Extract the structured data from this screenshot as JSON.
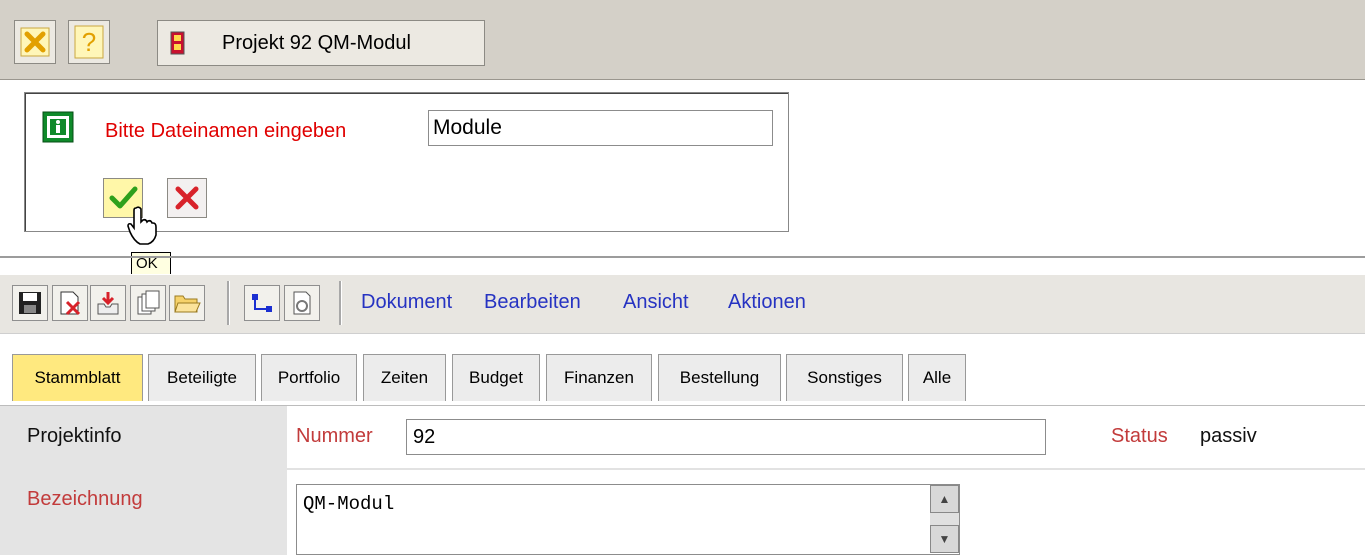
{
  "header": {
    "project_button_label": "Projekt 92 QM-Modul",
    "icons": [
      "close-icon",
      "help-icon",
      "project-icon"
    ]
  },
  "dialog": {
    "label": "Bitte Dateinamen eingeben",
    "filename_value": "Module",
    "ok_tooltip": "OK",
    "icons": [
      "info-icon",
      "ok-check-icon",
      "cancel-x-icon"
    ]
  },
  "toolbar": {
    "icons": [
      "save-icon",
      "delete-doc-icon",
      "inbox-icon",
      "copy-icon",
      "open-folder-icon",
      "workflow-icon",
      "refresh-doc-icon"
    ],
    "menus": [
      "Dokument",
      "Bearbeiten",
      "Ansicht",
      "Aktionen"
    ]
  },
  "tabs": [
    "Stammblatt",
    "Beteiligte",
    "Portfolio",
    "Zeiten",
    "Budget",
    "Finanzen",
    "Bestellung",
    "Sonstiges",
    "Alle"
  ],
  "active_tab": "Stammblatt",
  "form": {
    "section_label": "Projektinfo",
    "nummer_label": "Nummer",
    "nummer_value": "92",
    "status_label": "Status",
    "status_value": "passiv",
    "bezeichnung_label": "Bezeichnung",
    "bezeichnung_value": "QM-Modul"
  },
  "colors": {
    "accent_red": "#e00000",
    "label_red": "#c23b3b",
    "menu_blue": "#2633c2",
    "active_tab": "#ffe97f",
    "chrome": "#d4d0c8"
  }
}
